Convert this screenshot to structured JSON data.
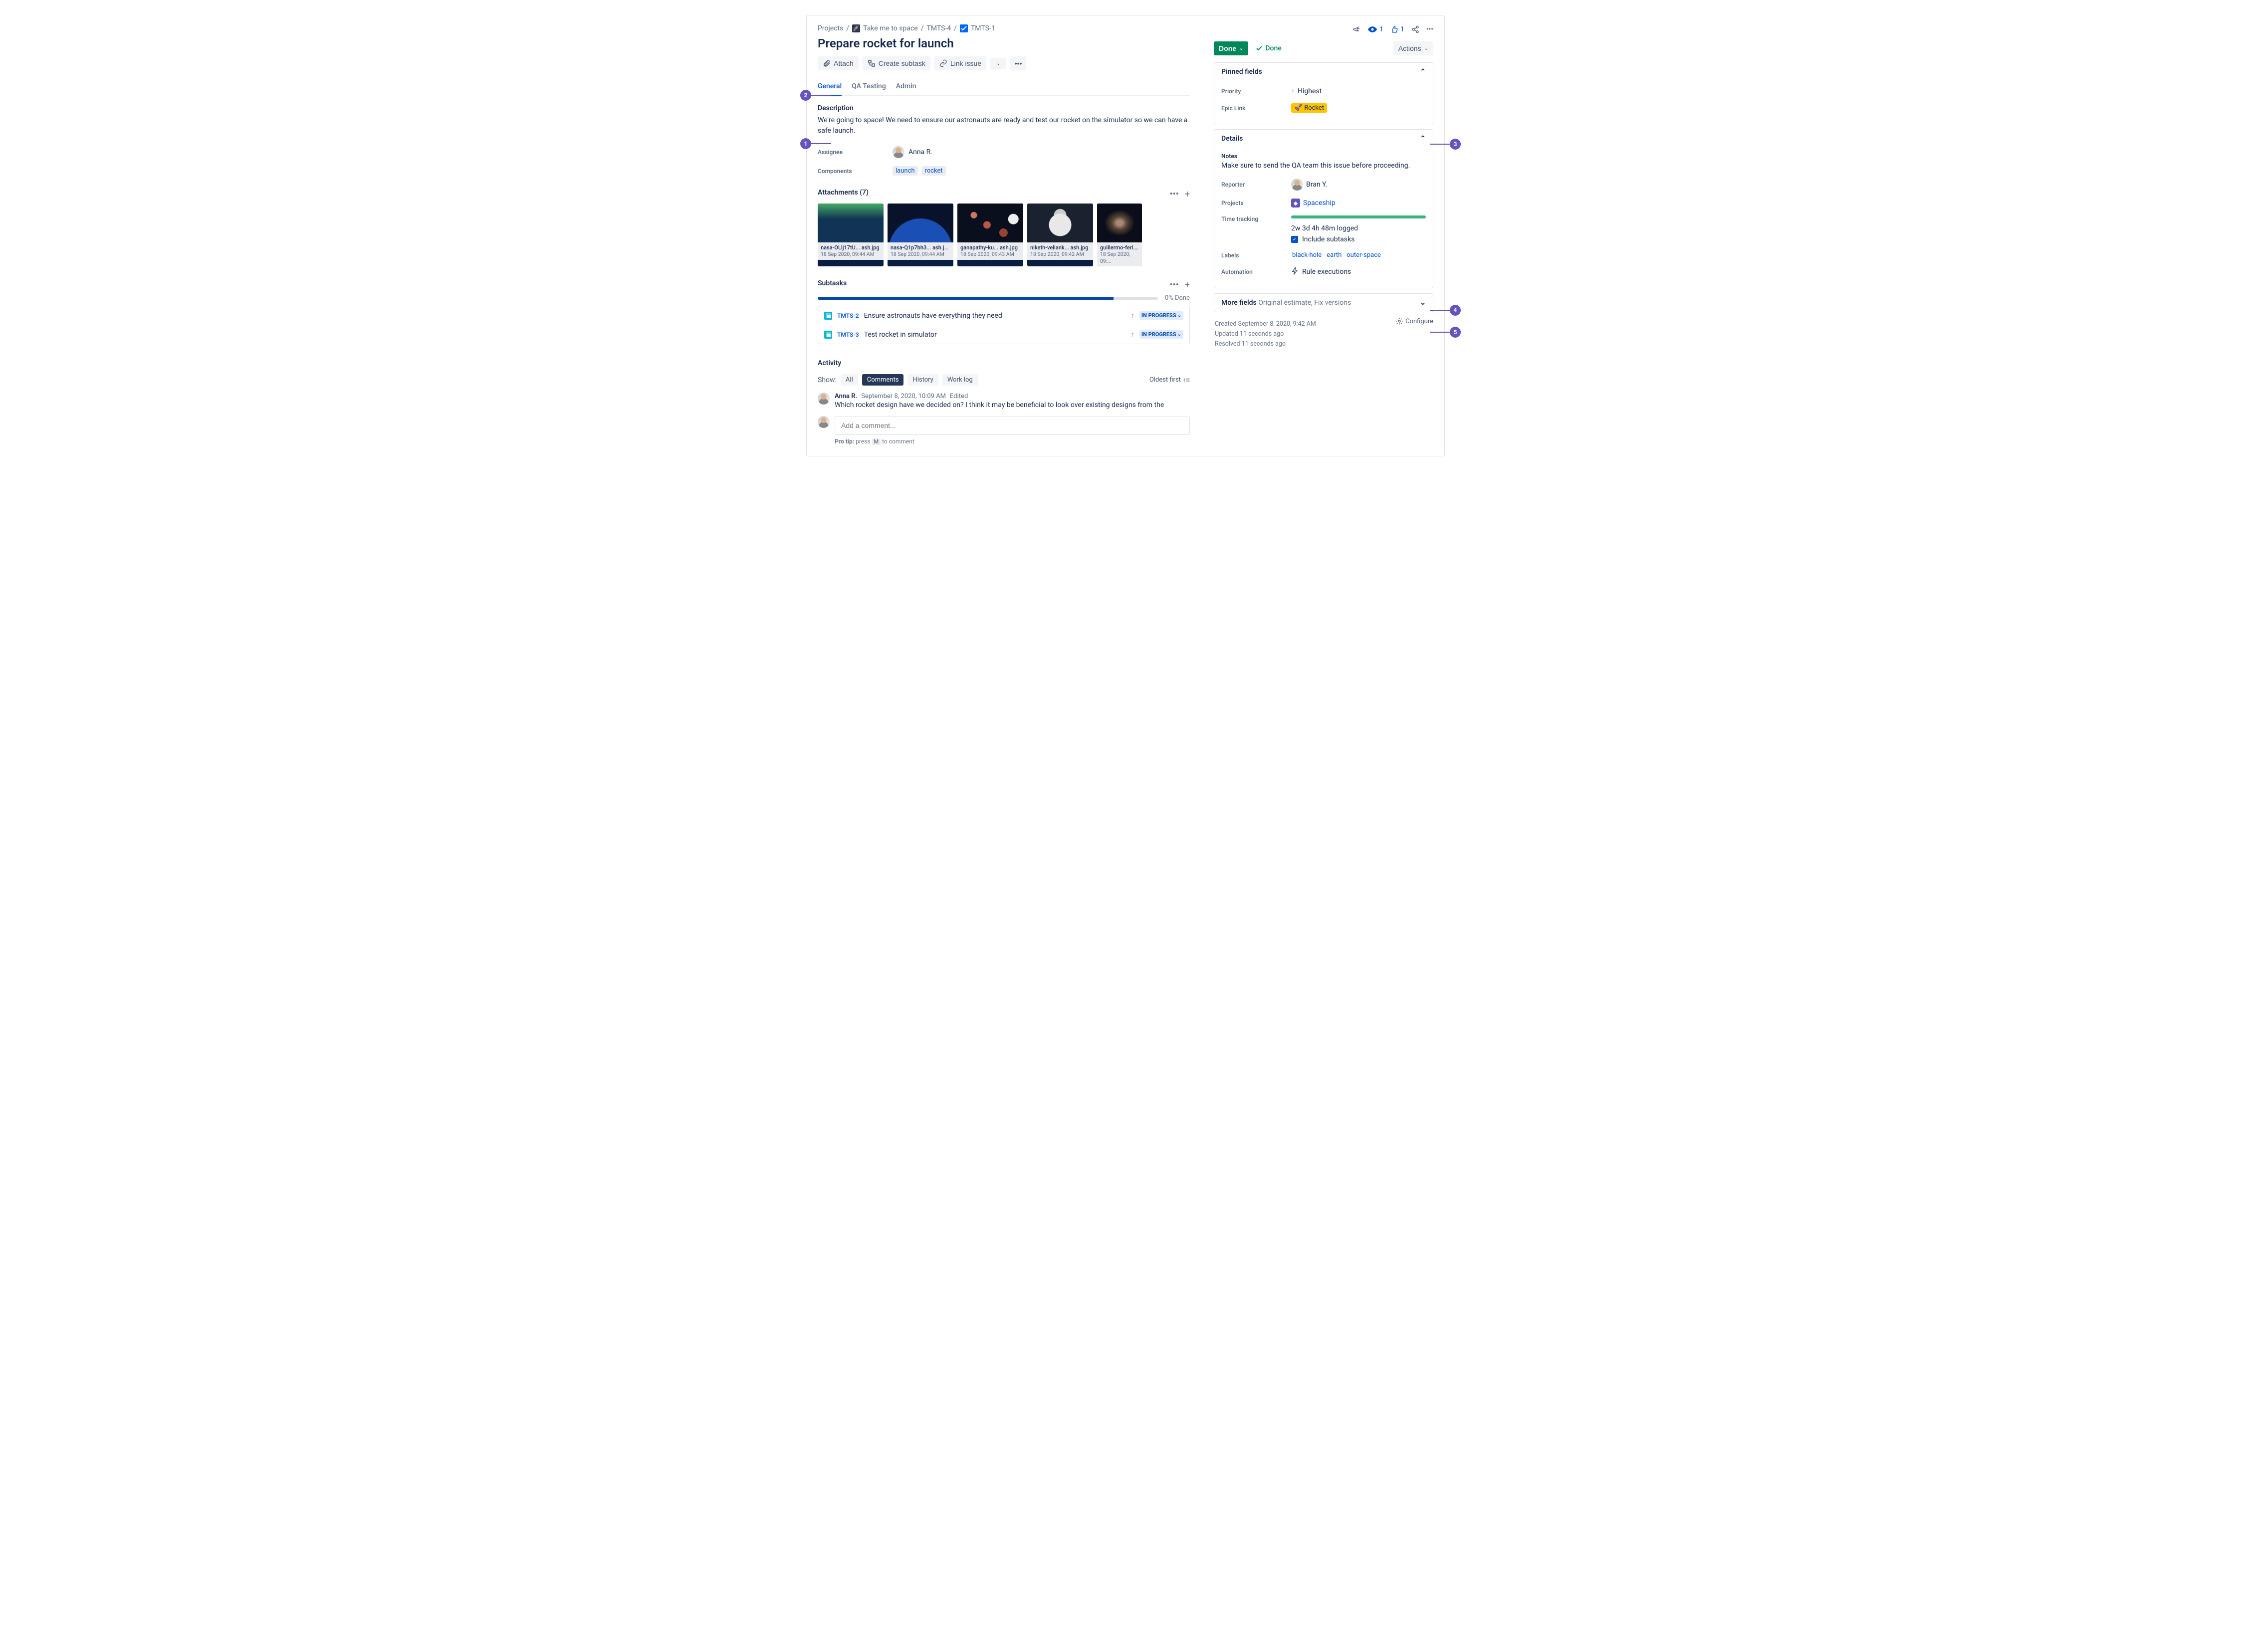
{
  "breadcrumbs": {
    "projects": "Projects",
    "project_name": "Take me to space",
    "parent_key": "TMTS-4",
    "issue_key": "TMTS-1"
  },
  "title": "Prepare rocket for launch",
  "toolbar": {
    "attach": "Attach",
    "create_subtask": "Create subtask",
    "link_issue": "Link issue"
  },
  "tabs": [
    "General",
    "QA Testing",
    "Admin"
  ],
  "description": {
    "heading": "Description",
    "text": "We're going to space! We need to ensure our astronauts are ready and test our rocket on the simulator so we can have a safe launch."
  },
  "assignee": {
    "label": "Assignee",
    "name": "Anna R."
  },
  "components": {
    "label": "Components",
    "items": [
      "launch",
      "rocket"
    ]
  },
  "attachments": {
    "heading": "Attachments (7)",
    "items": [
      {
        "file": "nasa-OLlj17tU... ash.jpg",
        "ts": "18 Sep 2020, 09:44 AM"
      },
      {
        "file": "nasa-Q1p7bh3... ash.jpg",
        "ts": "18 Sep 2020, 09:44 AM"
      },
      {
        "file": "ganapathy-ku... ash.jpg",
        "ts": "18 Sep 2020, 09:43 AM"
      },
      {
        "file": "niketh-vellank... ash.jpg",
        "ts": "18 Sep 2020, 09:42 AM"
      },
      {
        "file": "guillermo-ferl... a...",
        "ts": "18 Sep 2020, 09:..."
      }
    ]
  },
  "subtasks": {
    "heading": "Subtasks",
    "progress_pct": "0% Done",
    "items": [
      {
        "key": "TMTS-2",
        "title": "Ensure astronauts have everything they need",
        "status": "IN PROGRESS"
      },
      {
        "key": "TMTS-3",
        "title": "Test rocket in simulator",
        "status": "IN PROGRESS"
      }
    ]
  },
  "activity": {
    "heading": "Activity",
    "show_label": "Show:",
    "filters": [
      "All",
      "Comments",
      "History",
      "Work log"
    ],
    "sort": "Oldest first",
    "comment": {
      "author": "Anna R.",
      "time": "September 8, 2020, 10:09 AM",
      "edited": "Edited",
      "text": "Which rocket design have we decided on? I think it may be beneficial to look over existing designs from the"
    },
    "add_placeholder": "Add a comment...",
    "protip_a": "Pro tip:",
    "protip_b": "press",
    "protip_key": "M",
    "protip_c": "to comment"
  },
  "header_right": {
    "watchers": "1",
    "votes": "1"
  },
  "status_button": "Done",
  "status_label": "Done",
  "actions_label": "Actions",
  "pinned": {
    "heading": "Pinned fields",
    "priority_label": "Priority",
    "priority_value": "Highest",
    "epic_label": "Epic Link",
    "epic_value": "Rocket"
  },
  "details": {
    "heading": "Details",
    "notes_label": "Notes",
    "notes_text": "Make sure to send the QA team this issue before proceeding.",
    "reporter_label": "Reporter",
    "reporter_name": "Bran Y.",
    "projects_label": "Projects",
    "projects_value": "Spaceship",
    "tt_label": "Time tracking",
    "tt_value": "2w 3d 4h 48m logged",
    "tt_subtasks": "Include subtasks",
    "labels_label": "Labels",
    "labels_values": [
      "black-hole",
      "earth",
      "outer-space"
    ],
    "auto_label": "Automation",
    "auto_value": "Rule executions"
  },
  "more_fields": {
    "heading": "More fields",
    "hint": "Original estimate, Fix versions"
  },
  "meta": {
    "created": "Created September 8, 2020, 9:42 AM",
    "updated": "Updated 11 seconds ago",
    "resolved": "Resolved 11 seconds ago",
    "configure": "Configure"
  },
  "callouts": [
    "1",
    "2",
    "3",
    "4",
    "5"
  ]
}
